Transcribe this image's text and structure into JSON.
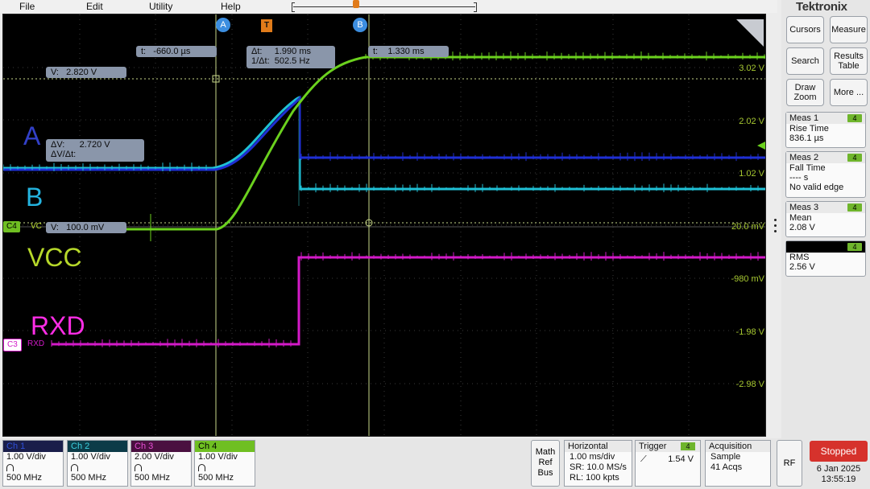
{
  "menu": [
    "File",
    "Edit",
    "Utility",
    "Help"
  ],
  "brand": "Tektronix",
  "colors": {
    "ch1": "#1f2fd4",
    "ch2": "#1fc1d6",
    "ch3": "#d31ac8",
    "ch4": "#6bd11e",
    "ch_label_a": "#3240c8",
    "ch_label_b": "#24b4e0",
    "ch_label_vcc": "#b6d82a",
    "ch_label_rxd": "#ff2de6",
    "cursor": "#c9d88a",
    "stopped": "#d6322c"
  },
  "screen": {
    "cursor_a_label": "A",
    "cursor_b_label": "B",
    "trigger_marker": "T",
    "readout_t_a": "t:   -660.0 µs",
    "readout_v_a": "V:   2.820 V",
    "readout_dt": "Δt:     1.990 ms\n1/Δt:  502.5 Hz",
    "readout_t_b": "t:    1.330 ms",
    "readout_dv": "ΔV:      2.720 V\nΔV/Δt:",
    "readout_v_b": "V:   100.0 mV",
    "channel_labels": [
      "A",
      "B",
      "VCC",
      "RXD"
    ],
    "scale_labels": [
      "3.02 V",
      "2.02 V",
      "1.02 V",
      "20.0 mV",
      "-980 mV",
      "-1.98 V",
      "-2.98 V"
    ],
    "ch4_tag": "C4",
    "ch4_tag_text": "VC",
    "ch3_tag": "C3",
    "ch3_tag_text": "RXD"
  },
  "panel": {
    "buttons": [
      "Cursors",
      "Measure",
      "Search",
      "Results Table",
      "Draw Zoom",
      "More ..."
    ],
    "measurements": [
      {
        "title": "Meas 1",
        "badge": "4",
        "lines": [
          "Rise Time",
          "836.1 µs"
        ]
      },
      {
        "title": "Meas 2",
        "badge": "4",
        "lines": [
          "Fall Time",
          "---- s",
          "No valid edge"
        ]
      },
      {
        "title": "Meas 3",
        "badge": "4",
        "lines": [
          "Mean",
          "2.08 V"
        ]
      },
      {
        "title": "",
        "badge": "4",
        "lines": [
          "RMS",
          "2.56 V"
        ]
      }
    ]
  },
  "channels": [
    {
      "name": "Ch 1",
      "scale": "1.00 V/div",
      "bw": "500 MHz",
      "header_color": "#1a1e4a",
      "text_color": "#2f4fd9"
    },
    {
      "name": "Ch 2",
      "scale": "1.00 V/div",
      "bw": "500 MHz",
      "header_color": "#0c3b48",
      "text_color": "#3dd0e0"
    },
    {
      "name": "Ch 3",
      "scale": "2.00 V/div",
      "bw": "500 MHz",
      "header_color": "#4a1040",
      "text_color": "#e64fd5"
    },
    {
      "name": "Ch 4",
      "scale": "1.00 V/div",
      "bw": "500 MHz",
      "header_color": "#6fbf22",
      "text_color": "#000000"
    }
  ],
  "math_ref_bus": [
    "Math",
    "Ref",
    "Bus"
  ],
  "horizontal": {
    "title": "Horizontal",
    "lines": [
      "1.00 ms/div",
      "SR: 10.0 MS/s",
      "RL: 100 kpts"
    ]
  },
  "trigger": {
    "title": "Trigger",
    "badge": "4",
    "level": "1.54 V"
  },
  "acquisition": {
    "title": "Acquisition",
    "lines": [
      "Sample",
      "41 Acqs"
    ]
  },
  "rf": "RF",
  "status": "Stopped",
  "date": "6 Jan 2025",
  "time": "13:55:19"
}
